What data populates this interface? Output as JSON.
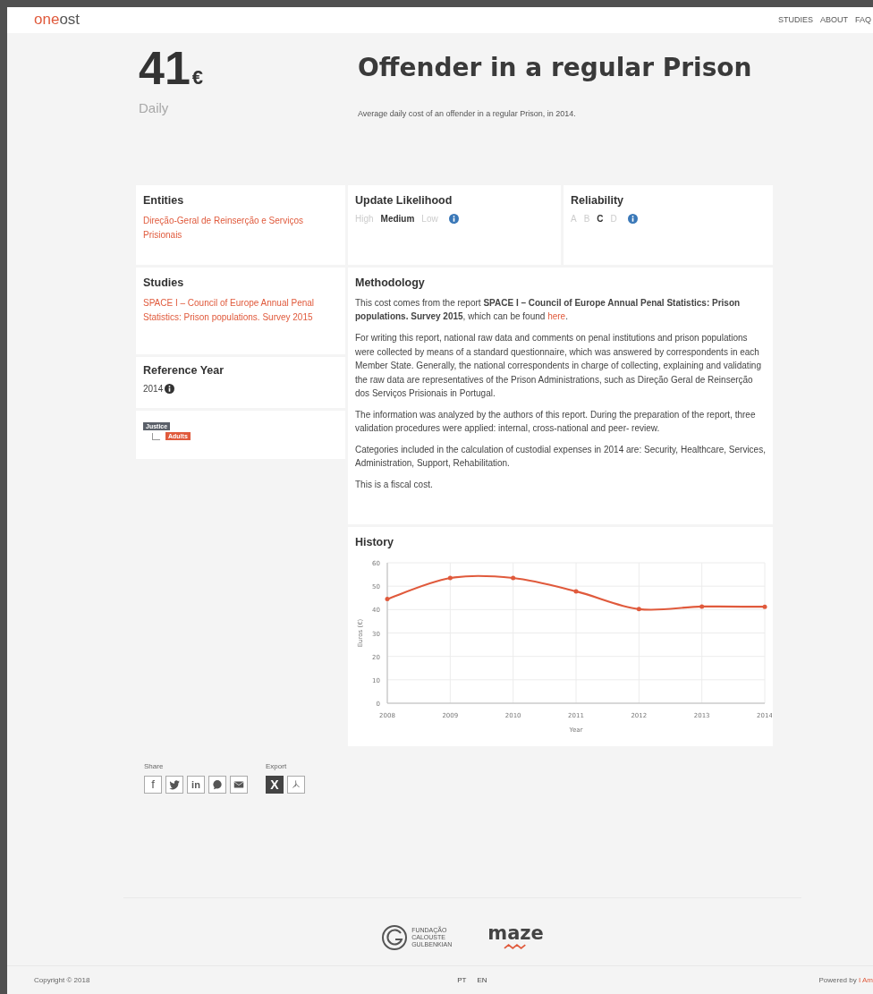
{
  "header": {
    "logo": {
      "accent": "one",
      "rest": "ost"
    },
    "nav": [
      "STUDIES",
      "ABOUT",
      "FAQ"
    ]
  },
  "hero": {
    "amount": "41",
    "currency": "€",
    "period": "Daily",
    "title": "Offender in a regular Prison",
    "description": "Average daily cost of an offender in a regular Prison, in 2014."
  },
  "entities": {
    "title": "Entities",
    "links": [
      "Direção-Geral de Reinserção e Serviços Prisionais"
    ]
  },
  "update_likelihood": {
    "title": "Update Likelihood",
    "options": [
      {
        "label": "High",
        "selected": false
      },
      {
        "label": "Medium",
        "selected": true
      },
      {
        "label": "Low",
        "selected": false
      }
    ]
  },
  "reliability": {
    "title": "Reliability",
    "options": [
      {
        "label": "A",
        "selected": false
      },
      {
        "label": "B",
        "selected": false
      },
      {
        "label": "C",
        "selected": true
      },
      {
        "label": "D",
        "selected": false
      }
    ]
  },
  "studies": {
    "title": "Studies",
    "links": [
      "SPACE I – Council of Europe Annual Penal Statistics: Prison populations. Survey 2015"
    ]
  },
  "reference_year": {
    "title": "Reference Year",
    "value": "2014"
  },
  "tags": [
    {
      "label": "Justice",
      "color": "#5b6069",
      "children": [
        {
          "label": "Adults",
          "color": "#e05a3c"
        }
      ]
    }
  ],
  "methodology": {
    "title": "Methodology",
    "paragraphs": [
      {
        "text": "This cost comes from the report **SPACE I – Council of Europe Annual Penal Statistics: Prison populations. Survey 2015**, which can be found",
        "link": "here",
        "after": "."
      },
      {
        "text": "For writing this report, national raw data and comments on penal institutions and prison populations were collected by means of a standard questionnaire, which was answered by correspondents in each Member State. Generally, the national correspondents in charge of collecting, explaining and validating the raw data are representatives of the Prison Administrations, such as Direção Geral de Reinserção dos Serviços Prisionais in Portugal."
      },
      {
        "text": "The information was analyzed by the authors of this report. During the preparation of the report, three validation procedures were applied: internal, cross-national and peer- review."
      },
      {
        "text": "Categories included in the calculation of custodial expenses in 2014 are: Security, Healthcare, Services, Administration, Support, Rehabilitation."
      },
      {
        "text": "This is a fiscal cost."
      }
    ]
  },
  "history": {
    "title": "History",
    "chart_data": {
      "type": "line",
      "xlabel": "Year",
      "ylabel": "Euros (€)",
      "categories": [
        "2008",
        "2009",
        "2010",
        "2011",
        "2012",
        "2013",
        "2014"
      ],
      "grid": true,
      "series": [
        {
          "color": "#e05a3c",
          "values": [
            44.5,
            53.5,
            53.5,
            47.8,
            40.2,
            41.3,
            41.2
          ]
        }
      ],
      "ylim": [
        0,
        60
      ],
      "yticks": [
        0,
        10,
        20,
        30,
        40,
        50,
        60
      ]
    }
  },
  "share": {
    "label": "Share",
    "items": [
      {
        "kind": "facebook",
        "glyph": "f"
      },
      {
        "kind": "twitter"
      },
      {
        "kind": "linkedin",
        "glyph": "in"
      },
      {
        "kind": "whatsapp"
      },
      {
        "kind": "email"
      }
    ]
  },
  "export": {
    "label": "Export",
    "items": [
      {
        "kind": "excel",
        "glyph": "X"
      },
      {
        "kind": "pdf"
      }
    ]
  },
  "sponsors": [
    {
      "kind": "gulbenkian",
      "lines": [
        "FUNDAÇÃO",
        "CALOUSTE",
        "GULBENKIAN"
      ]
    },
    {
      "kind": "maze",
      "name": "maze"
    }
  ],
  "footer": {
    "copyright": "Copyright © 2018",
    "languages": [
      "PT",
      "EN"
    ],
    "powered": "Powered by",
    "powered_link": "I Am"
  }
}
